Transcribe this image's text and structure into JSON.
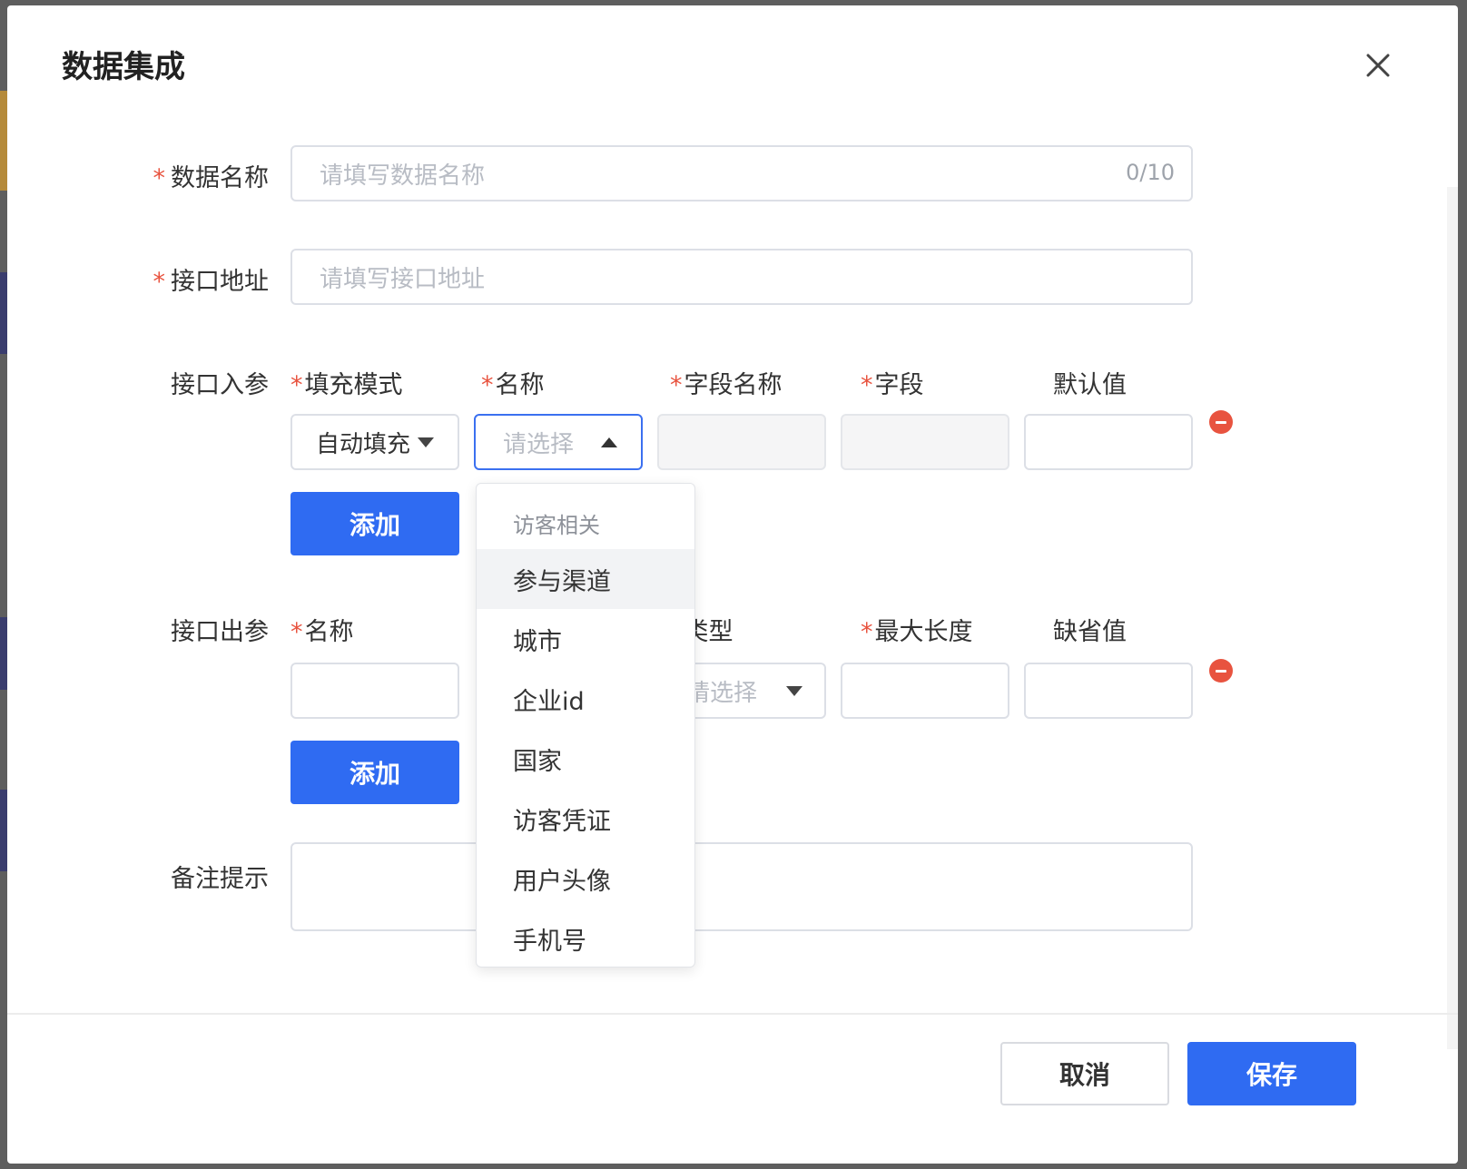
{
  "dialog": {
    "title": "数据集成",
    "close_label": "×"
  },
  "form": {
    "required_mark": "*",
    "data_name": {
      "label": "数据名称",
      "placeholder": "请填写数据名称",
      "counter": "0/10"
    },
    "api_url": {
      "label": "接口地址",
      "placeholder": "请填写接口地址"
    },
    "input_params": {
      "label": "接口入参",
      "columns": [
        "填充模式",
        "名称",
        "字段名称",
        "字段",
        "默认值"
      ],
      "fill_mode_value": "自动填充",
      "name_placeholder": "请选择",
      "add_label": "添加"
    },
    "output_params": {
      "label": "接口出参",
      "columns": [
        "名称",
        "类型",
        "最大长度",
        "缺省值"
      ],
      "type_placeholder": "请选择",
      "add_label": "添加"
    },
    "remark": {
      "label": "备注提示"
    }
  },
  "dropdown": {
    "group_label": "访客相关",
    "options": [
      "参与渠道",
      "城市",
      "企业id",
      "国家",
      "访客凭证",
      "用户头像",
      "手机号"
    ],
    "hovered_index": 0
  },
  "footer": {
    "cancel_label": "取消",
    "save_label": "保存"
  },
  "colors": {
    "primary": "#2f6bf2",
    "required": "#e8533f",
    "remove": "#e8533f"
  }
}
